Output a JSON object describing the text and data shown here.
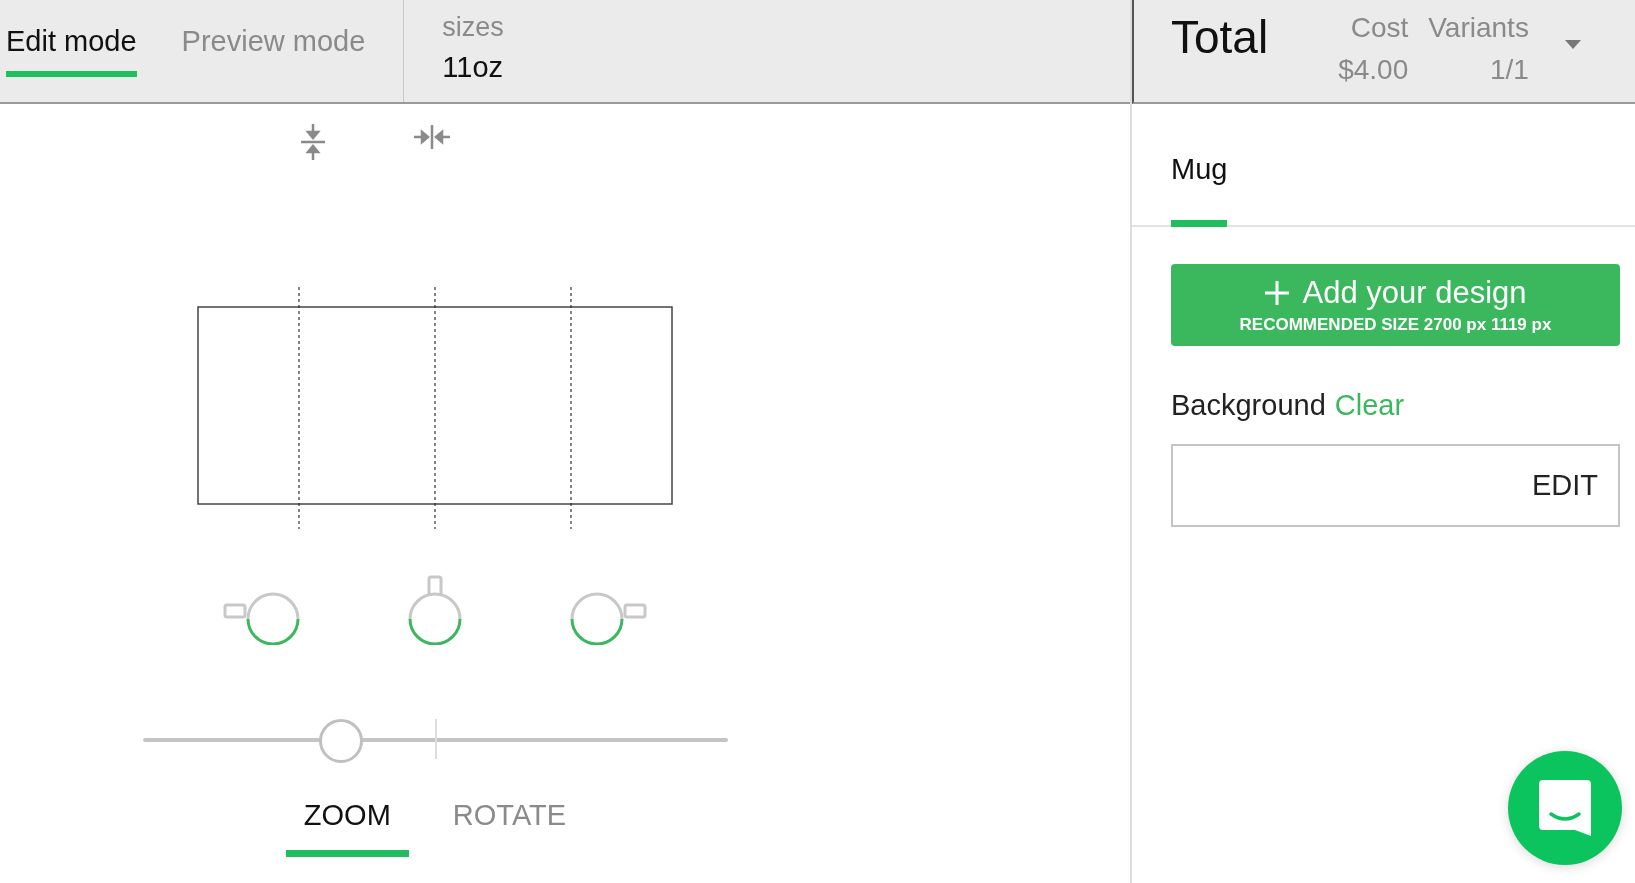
{
  "mode_tabs": [
    {
      "label": "Edit mode",
      "selected": true
    },
    {
      "label": "Preview mode",
      "selected": false
    }
  ],
  "sizes": {
    "label": "sizes",
    "value": "11oz"
  },
  "total": {
    "title": "Total",
    "columns": [
      {
        "label": "Cost",
        "value": "$4.00"
      },
      {
        "label": "Variants",
        "value": "1/1"
      }
    ]
  },
  "mug_views": [
    {
      "kind": "left"
    },
    {
      "kind": "top"
    },
    {
      "kind": "right"
    }
  ],
  "slider": {
    "level": 0.34
  },
  "tool_tabs": [
    {
      "label": "ZOOM",
      "selected": true
    },
    {
      "label": "ROTATE",
      "selected": false
    }
  ],
  "product_tabs": [
    {
      "label": "Mug",
      "selected": true
    }
  ],
  "add_design": {
    "label": "Add your design",
    "hint": "RECOMMENDED SIZE 2700 px 1119 px"
  },
  "background": {
    "label": "Background",
    "action": "Clear",
    "button": "EDIT"
  }
}
